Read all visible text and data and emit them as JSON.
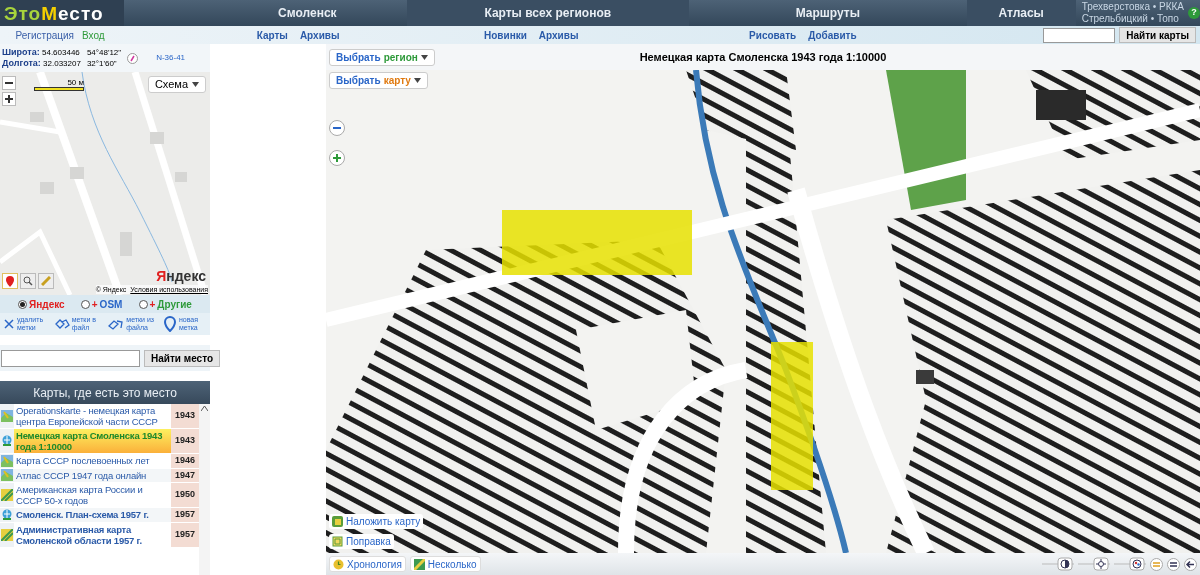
{
  "logo": {
    "part1": "Это",
    "part2": "М",
    "part3": "есто"
  },
  "nav": [
    {
      "label": "Смоленск",
      "sub": [
        "Карты",
        "Архивы"
      ]
    },
    {
      "label": "Карты всех регионов",
      "sub": [
        "Новинки",
        "Архивы"
      ]
    },
    {
      "label": "Маршруты",
      "sub": [
        "Рисовать",
        "Добавить"
      ]
    },
    {
      "label": "Атласы"
    }
  ],
  "atlas_links": [
    "Трехверстовка • РККА",
    "Стрельбицкий • Топо"
  ],
  "help": "?",
  "auth": [
    {
      "label": "Регистрация",
      "color": "#3a5fa8"
    },
    {
      "label": "Вход",
      "color": "#2e9a3a"
    }
  ],
  "map_search": {
    "button": "Найти карты"
  },
  "coords": {
    "lat_label": "Широта:",
    "lat": "54.603446",
    "lat_dms": "54°48'12\"",
    "lon_label": "Долгота:",
    "lon": "32.033207",
    "lon_dms": "32°1'60\"",
    "sheet": "N-36-41"
  },
  "mini_map": {
    "scale": "50 м",
    "layer_button": "Схема",
    "copyright": "© Яндекс",
    "terms": "Условия использования",
    "logo": "Яндекс"
  },
  "providers": [
    {
      "label": "Яндекс",
      "selected": true,
      "color": "#e02020"
    },
    {
      "prefix": "+",
      "label": "OSM",
      "selected": false,
      "color": "#2a66c8"
    },
    {
      "prefix": "+",
      "label": "Другие",
      "selected": false,
      "color": "#2e9a3a"
    }
  ],
  "actions": [
    {
      "kind": "delete",
      "label": "удалить метки"
    },
    {
      "kind": "export",
      "label": "метки в файл"
    },
    {
      "kind": "import",
      "label": "метки из файла"
    },
    {
      "kind": "new",
      "label": "новая метка"
    }
  ],
  "place_search": {
    "button": "Найти место"
  },
  "list": {
    "title": "Карты, где есть это место",
    "rows": [
      {
        "kind": "map",
        "title": "Operationskarte - немецкая карта центра Европейской части СССР",
        "year": "1943",
        "selected": false,
        "bold": false
      },
      {
        "kind": "city",
        "title": "Немецкая карта Смоленска 1943 года 1:10000",
        "year": "1943",
        "selected": true,
        "bold": true
      },
      {
        "kind": "map",
        "title": "Карта СССР послевоенных лет",
        "year": "1946",
        "selected": false,
        "bold": false
      },
      {
        "kind": "map",
        "title": "Атлас СССР 1947 года онлайн",
        "year": "1947",
        "selected": false,
        "bold": false
      },
      {
        "kind": "relief",
        "title": "Американская карта России и СССР 50-х годов",
        "year": "1950",
        "selected": false,
        "bold": false
      },
      {
        "kind": "city",
        "title": "Смоленск. План-схема 1957 г.",
        "year": "1957",
        "selected": false,
        "bold": true
      },
      {
        "kind": "relief",
        "title": "Административная карта Смоленской области 1957 г.",
        "year": "1957",
        "selected": false,
        "bold": true
      }
    ]
  },
  "viewer": {
    "title": "Немецкая карта Смоленска 1943 года 1:10000",
    "pickers": [
      {
        "label": "Выбрать",
        "accent": "регион",
        "color": "#2e9a3a"
      },
      {
        "label": "Выбрать",
        "accent": "карту",
        "color": "#e07a10"
      }
    ],
    "overlay_buttons": [
      {
        "kind": "overlay",
        "label": "Наложить карту"
      },
      {
        "kind": "fix",
        "label": "Поправка"
      }
    ],
    "bottom_buttons": [
      {
        "kind": "chrono",
        "label": "Хронология"
      },
      {
        "kind": "multi",
        "label": "Несколько"
      }
    ],
    "sliders": [
      {
        "kind": "contrast",
        "level": 0.5
      },
      {
        "kind": "brightness",
        "level": 0.5
      },
      {
        "kind": "color",
        "level": 0.5
      }
    ]
  }
}
